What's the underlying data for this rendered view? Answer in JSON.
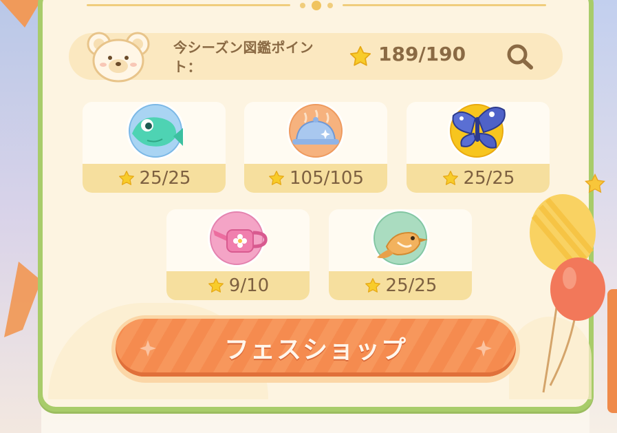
{
  "points": {
    "label": "今シーズン図鑑ポイント：",
    "value": "189/190"
  },
  "categories": [
    {
      "name": "fish",
      "count": "25/25"
    },
    {
      "name": "food",
      "count": "105/105"
    },
    {
      "name": "insect",
      "count": "25/25"
    },
    {
      "name": "gardening",
      "count": "9/10"
    },
    {
      "name": "bird",
      "count": "25/25"
    }
  ],
  "shop_button": {
    "label": "フェスショップ"
  },
  "icons": {
    "avatar": "bear-face-icon",
    "star": "star-icon",
    "search": "magnifier-icon"
  },
  "colors": {
    "panel_border": "#a8cc6a",
    "panel_bg": "#fdf4e1",
    "card_footer": "#f6df9e",
    "shop_button": "#f58b4f",
    "text": "#8a6a44"
  }
}
